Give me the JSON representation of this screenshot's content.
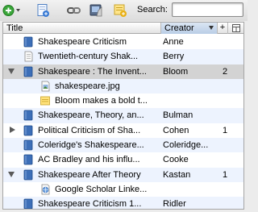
{
  "toolbar": {
    "buttons": [
      {
        "name": "new-item-button",
        "icon": "green-plus-icon"
      },
      {
        "name": "new-note-button",
        "icon": "blue-page-plus-icon"
      },
      {
        "name": "link-button",
        "icon": "chain-link-icon"
      },
      {
        "name": "attach-button",
        "icon": "attachment-icon"
      },
      {
        "name": "standalone-note-button",
        "icon": "yellow-note-plus-icon"
      }
    ],
    "search_label": "Search:",
    "search_value": ""
  },
  "columns": {
    "title": "Title",
    "creator": "Creator",
    "add_column": "+",
    "column_picker": "⊞"
  },
  "rows": [
    {
      "twisty": "none",
      "level": 0,
      "icon": "book-icon",
      "title": "Shakespeare Criticism",
      "creator": "Anne",
      "count": ""
    },
    {
      "twisty": "none",
      "level": 0,
      "icon": "document-icon",
      "title": "Twentieth-century Shak...",
      "creator": "Berry",
      "count": ""
    },
    {
      "twisty": "open",
      "level": 0,
      "icon": "book-icon",
      "title": "Shakespeare : The Invent...",
      "creator": "Bloom",
      "count": "2"
    },
    {
      "twisty": "none",
      "level": 1,
      "icon": "image-file-icon",
      "title": "shakespeare.jpg",
      "creator": "",
      "count": ""
    },
    {
      "twisty": "none",
      "level": 1,
      "icon": "note-icon",
      "title": "Bloom makes a bold t...",
      "creator": "",
      "count": ""
    },
    {
      "twisty": "none",
      "level": 0,
      "icon": "book-icon",
      "title": "Shakespeare, Theory, an...",
      "creator": "Bulman",
      "count": ""
    },
    {
      "twisty": "closed",
      "level": 0,
      "icon": "book-icon",
      "title": "Political Criticism of Sha...",
      "creator": "Cohen",
      "count": "1"
    },
    {
      "twisty": "none",
      "level": 0,
      "icon": "book-icon",
      "title": "Coleridge's Shakespeare...",
      "creator": "Coleridge...",
      "count": ""
    },
    {
      "twisty": "none",
      "level": 0,
      "icon": "book-icon",
      "title": "AC Bradley and his influ...",
      "creator": "Cooke",
      "count": ""
    },
    {
      "twisty": "open",
      "level": 0,
      "icon": "book-icon",
      "title": "Shakespeare After Theory",
      "creator": "Kastan",
      "count": "1"
    },
    {
      "twisty": "none",
      "level": 1,
      "icon": "web-link-icon",
      "title": "Google Scholar Linke...",
      "creator": "",
      "count": ""
    },
    {
      "twisty": "none",
      "level": 0,
      "icon": "book-icon",
      "title": "Shakespeare Criticism 1...",
      "creator": "Ridler",
      "count": ""
    }
  ],
  "selected_row": 2
}
